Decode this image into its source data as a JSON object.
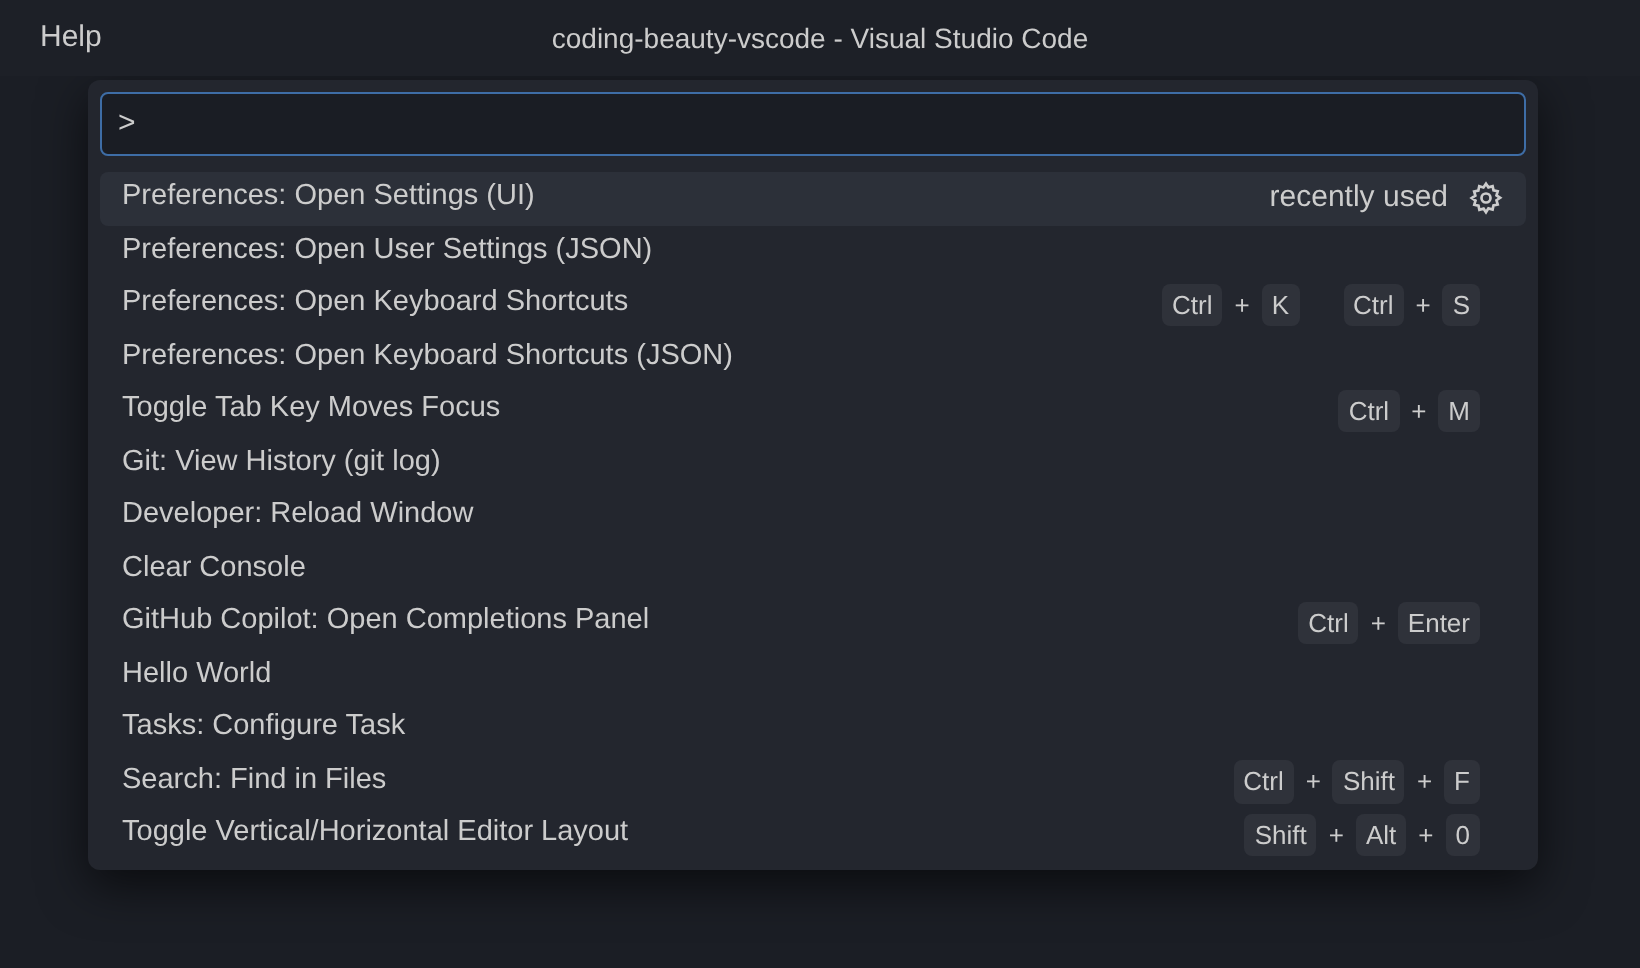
{
  "menu": {
    "label": "Help"
  },
  "window": {
    "title": "coding-beauty-vscode - Visual Studio Code"
  },
  "command_input": {
    "value": ">"
  },
  "commands": [
    {
      "label": "Preferences: Open Settings (UI)",
      "selected": true,
      "detail": "recently used"
    },
    {
      "label": "Preferences: Open User Settings (JSON)",
      "selected": false
    },
    {
      "label": "Preferences: Open Keyboard Shortcuts",
      "selected": false,
      "chords": [
        [
          "Ctrl",
          "+",
          "K"
        ],
        [
          "Ctrl",
          "+",
          "S"
        ]
      ]
    },
    {
      "label": "Preferences: Open Keyboard Shortcuts (JSON)",
      "selected": false
    },
    {
      "label": "Toggle Tab Key Moves Focus",
      "selected": false,
      "chords": [
        [
          "Ctrl",
          "+",
          "M"
        ]
      ]
    },
    {
      "label": "Git: View History (git log)",
      "selected": false
    },
    {
      "label": "Developer: Reload Window",
      "selected": false
    },
    {
      "label": "Clear Console",
      "selected": false
    },
    {
      "label": "GitHub Copilot: Open Completions Panel",
      "selected": false,
      "chords": [
        [
          "Ctrl",
          "+",
          "Enter"
        ]
      ]
    },
    {
      "label": "Hello World",
      "selected": false
    },
    {
      "label": "Tasks: Configure Task",
      "selected": false
    },
    {
      "label": "Search: Find in Files",
      "selected": false,
      "chords": [
        [
          "Ctrl",
          "+",
          "Shift",
          "+",
          "F"
        ]
      ]
    },
    {
      "label": "Toggle Vertical/Horizontal Editor Layout",
      "selected": false,
      "chords": [
        [
          "Shift",
          "+",
          "Alt",
          "+",
          "0"
        ]
      ]
    }
  ]
}
